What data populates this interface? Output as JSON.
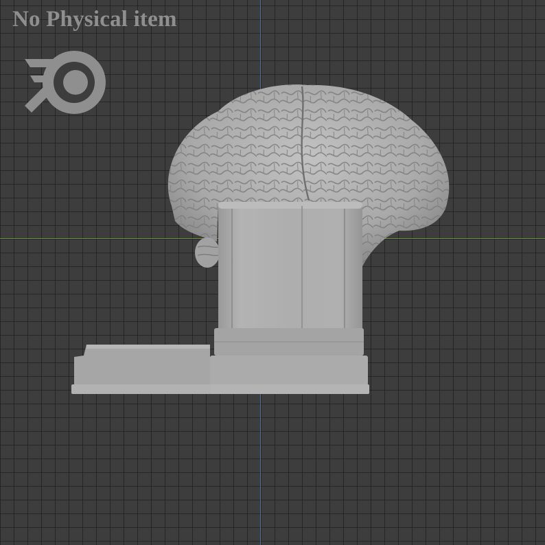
{
  "viewport": {
    "background_color": "#3d3d3d",
    "grid_color": "#262626",
    "y_axis_color": "#4f6ea6",
    "x_axis_color": "#6c8f3a"
  },
  "watermark": {
    "text": "No Physical item",
    "color": "#8f8f8f"
  },
  "logo": {
    "icon": "blender-logo-icon",
    "color": "#8f8f8f"
  },
  "model": {
    "parts": [
      "brain-icon",
      "column-base-icon",
      "tray-icon"
    ],
    "color": "#a8a8a8"
  }
}
